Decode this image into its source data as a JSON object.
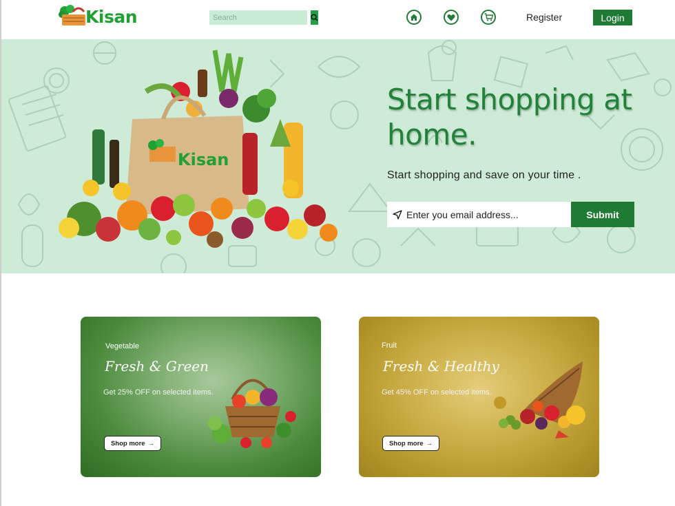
{
  "brand": {
    "name": "Kisan",
    "green": "#21a034",
    "dark_green": "#1f7a33"
  },
  "nav": {
    "search_placeholder": "Search",
    "icons": [
      "home-icon",
      "heart-icon",
      "cart-icon"
    ],
    "register_label": "Register",
    "login_label": "Login"
  },
  "hero": {
    "title": "Start shopping at home.",
    "subtitle": "Start shopping and save on your time .",
    "email_placeholder": "Enter you email address...",
    "submit_label": "Submit",
    "bag_label": "Kisan",
    "background": "#cdebd7"
  },
  "cards": [
    {
      "category": "Vegetable",
      "title": "Fresh & Green",
      "offer": "Get 25% OFF on selected items.",
      "button_label": "Shop more"
    },
    {
      "category": "Fruit",
      "title": "Fresh & Healthy",
      "offer": "Get 45% OFF on selected items.",
      "button_label": "Shop more"
    }
  ]
}
